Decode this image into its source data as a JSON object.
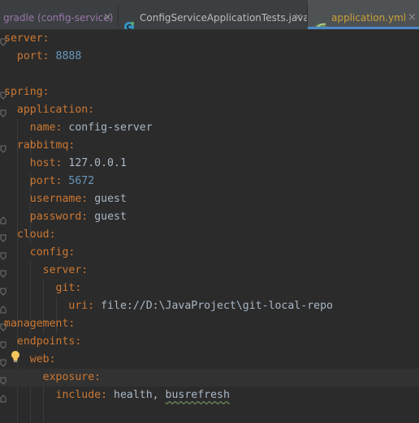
{
  "tabs": [
    {
      "label": "gradle (config-service)",
      "close": "×",
      "active": false
    },
    {
      "label": "ConfigServiceApplicationTests.java",
      "close": "×",
      "active": false
    },
    {
      "label": "application.yml",
      "close": "×",
      "active": true
    }
  ],
  "colors": {
    "background": "#2b2b2b",
    "key": "#cc7832",
    "value": "#a9b7c6",
    "number": "#6897bb",
    "active_tab_label": "#c9a03a",
    "active_tab_underline": "#4a88c7"
  },
  "icons": {
    "tests_tab": "junit-test-class-icon",
    "yml_tab": "spring-yaml-icon",
    "intention": "lightbulb-icon",
    "fold": "fold-marker-icon"
  },
  "code": [
    {
      "key": "server",
      "value": ""
    },
    {
      "key": "port",
      "value": "8888",
      "value_type": "number"
    },
    {
      "key": "",
      "value": ""
    },
    {
      "key": "spring",
      "value": ""
    },
    {
      "key": "application",
      "value": ""
    },
    {
      "key": "name",
      "value": "config-server"
    },
    {
      "key": "rabbitmq",
      "value": ""
    },
    {
      "key": "host",
      "value": "127.0.0.1"
    },
    {
      "key": "port",
      "value": "5672",
      "value_type": "number"
    },
    {
      "key": "username",
      "value": "guest"
    },
    {
      "key": "password",
      "value": "guest"
    },
    {
      "key": "cloud",
      "value": ""
    },
    {
      "key": "config",
      "value": ""
    },
    {
      "key": "server",
      "value": ""
    },
    {
      "key": "git",
      "value": ""
    },
    {
      "key": "uri",
      "value": "file://D:\\JavaProject\\git-local-repo"
    },
    {
      "key": "management",
      "value": ""
    },
    {
      "key": "endpoints",
      "value": ""
    },
    {
      "key": "web",
      "value": ""
    },
    {
      "key": "exposure",
      "value": ""
    },
    {
      "key": "include",
      "value": "health, ",
      "value_extra": "busrefresh"
    }
  ]
}
